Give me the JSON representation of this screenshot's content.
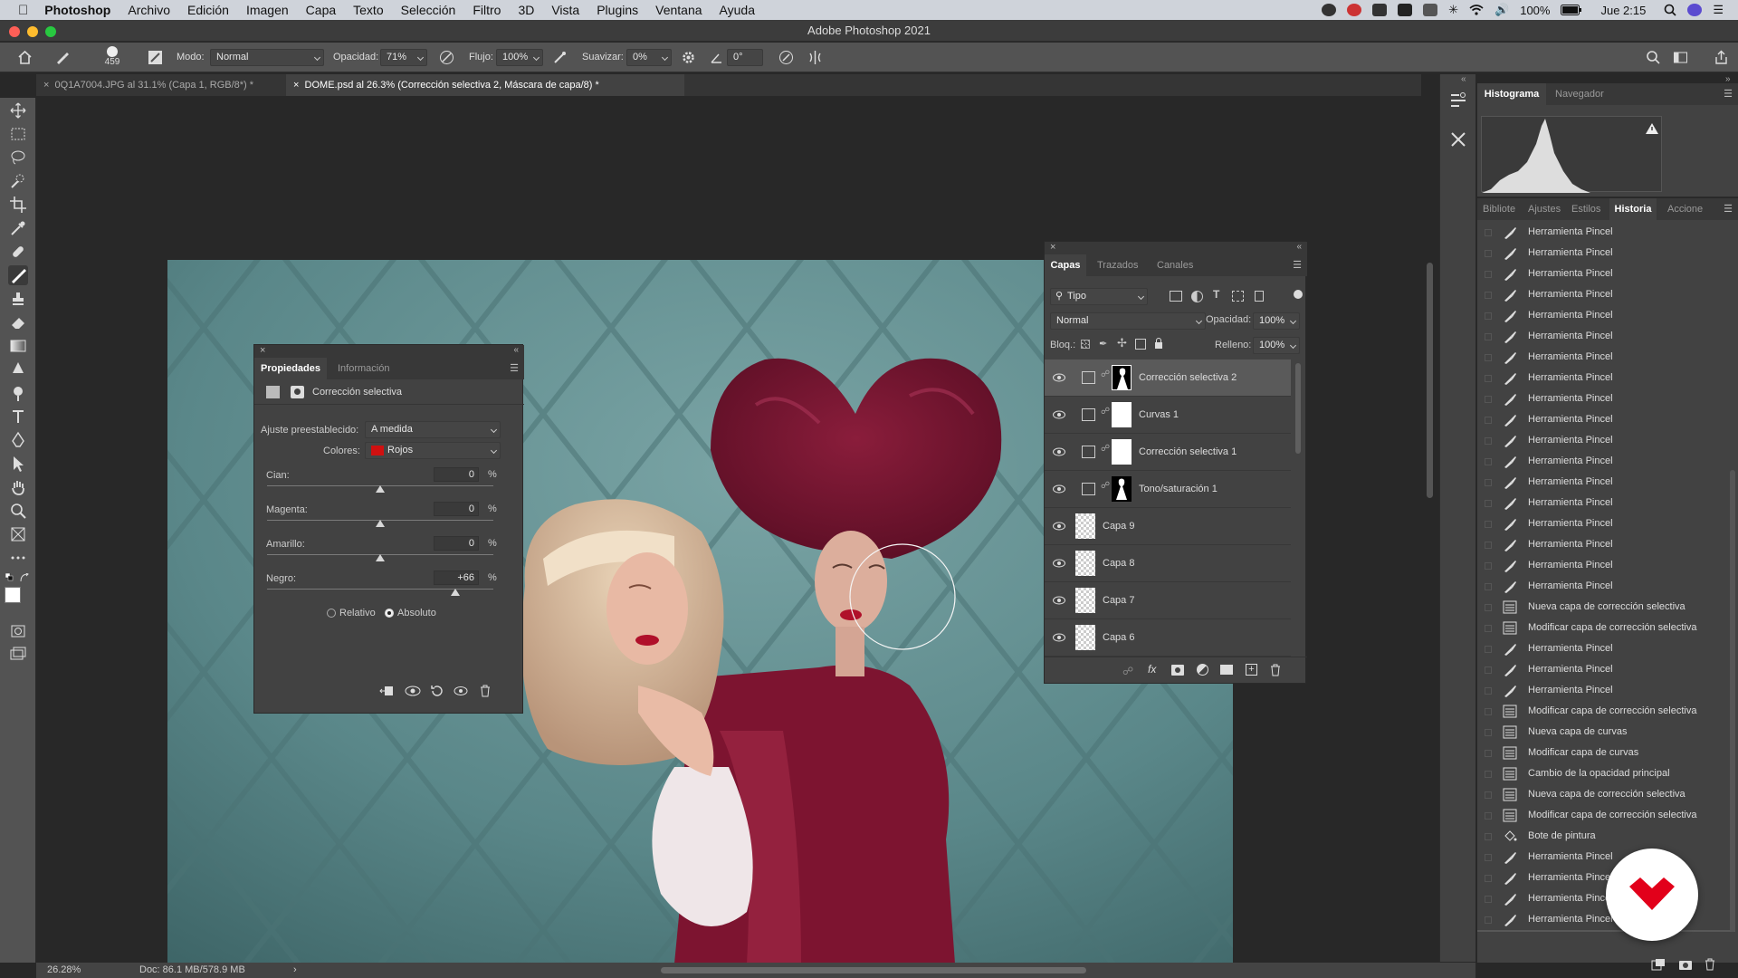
{
  "menubar": {
    "app": "Photoshop",
    "items": [
      "Archivo",
      "Edición",
      "Imagen",
      "Capa",
      "Texto",
      "Selección",
      "Filtro",
      "3D",
      "Vista",
      "Plugins",
      "Ventana",
      "Ayuda"
    ],
    "battery": "100%",
    "clock": "Jue 2:15"
  },
  "window": {
    "title": "Adobe Photoshop 2021"
  },
  "options": {
    "brush_size": "459",
    "mode_label": "Modo:",
    "mode_value": "Normal",
    "opacity_label": "Opacidad:",
    "opacity_value": "71%",
    "flow_label": "Flujo:",
    "flow_value": "100%",
    "smooth_label": "Suavizar:",
    "smooth_value": "0%",
    "angle_value": "0°"
  },
  "tabs": [
    {
      "label": "0Q1A7004.JPG al 31.1% (Capa 1, RGB/8*) *"
    },
    {
      "label": "DOME.psd al 26.3% (Corrección selectiva 2, Máscara de capa/8) *"
    }
  ],
  "properties": {
    "tabs": [
      "Propiedades",
      "Información"
    ],
    "header": "Corrección selectiva",
    "preset_label": "Ajuste preestablecido:",
    "preset_value": "A medida",
    "colors_label": "Colores:",
    "colors_value": "Rojos",
    "colors_swatch": "#d01010",
    "sliders": [
      {
        "label": "Cian:",
        "value": "0",
        "unit": "%",
        "level": 0
      },
      {
        "label": "Magenta:",
        "value": "0",
        "unit": "%",
        "level": 0
      },
      {
        "label": "Amarillo:",
        "value": "0",
        "unit": "%",
        "level": 0
      },
      {
        "label": "Negro:",
        "value": "+66",
        "unit": "%",
        "level": 66
      }
    ],
    "radio_relative": "Relativo",
    "radio_absolute": "Absoluto",
    "method_selected": "Absoluto"
  },
  "layers": {
    "tabs": [
      "Capas",
      "Trazados",
      "Canales"
    ],
    "filter_value": "Tipo",
    "blend_value": "Normal",
    "opacity_label": "Opacidad:",
    "opacity_value": "100%",
    "lock_label": "Bloq.:",
    "fill_label": "Relleno:",
    "fill_value": "100%",
    "items": [
      {
        "name": "Corrección selectiva 2",
        "kind": "adjust-selective",
        "mask": "figure",
        "selected": true
      },
      {
        "name": "Curvas 1",
        "kind": "adjust-curves",
        "mask": "white",
        "selected": false
      },
      {
        "name": "Corrección selectiva 1",
        "kind": "adjust-selective",
        "mask": "white",
        "selected": false
      },
      {
        "name": "Tono/saturación 1",
        "kind": "adjust-hue",
        "mask": "figure",
        "selected": false
      },
      {
        "name": "Capa 9",
        "kind": "pixel",
        "mask": "",
        "selected": false
      },
      {
        "name": "Capa 8",
        "kind": "pixel",
        "mask": "",
        "selected": false
      },
      {
        "name": "Capa 7",
        "kind": "pixel",
        "mask": "",
        "selected": false
      },
      {
        "name": "Capa 6",
        "kind": "pixel",
        "mask": "",
        "selected": false
      }
    ]
  },
  "histogram": {
    "tabs": [
      "Histograma",
      "Navegador"
    ]
  },
  "history": {
    "tabs": [
      "Bibliote",
      "Ajustes",
      "Estilos",
      "Historia",
      "Accione"
    ],
    "items": [
      {
        "label": "Herramienta Pincel",
        "icon": "brush"
      },
      {
        "label": "Herramienta Pincel",
        "icon": "brush"
      },
      {
        "label": "Herramienta Pincel",
        "icon": "brush"
      },
      {
        "label": "Herramienta Pincel",
        "icon": "brush"
      },
      {
        "label": "Herramienta Pincel",
        "icon": "brush"
      },
      {
        "label": "Herramienta Pincel",
        "icon": "brush"
      },
      {
        "label": "Herramienta Pincel",
        "icon": "brush"
      },
      {
        "label": "Herramienta Pincel",
        "icon": "brush"
      },
      {
        "label": "Herramienta Pincel",
        "icon": "brush"
      },
      {
        "label": "Herramienta Pincel",
        "icon": "brush"
      },
      {
        "label": "Herramienta Pincel",
        "icon": "brush"
      },
      {
        "label": "Herramienta Pincel",
        "icon": "brush"
      },
      {
        "label": "Herramienta Pincel",
        "icon": "brush"
      },
      {
        "label": "Herramienta Pincel",
        "icon": "brush"
      },
      {
        "label": "Herramienta Pincel",
        "icon": "brush"
      },
      {
        "label": "Herramienta Pincel",
        "icon": "brush"
      },
      {
        "label": "Herramienta Pincel",
        "icon": "brush"
      },
      {
        "label": "Herramienta Pincel",
        "icon": "brush"
      },
      {
        "label": "Nueva capa de corrección selectiva",
        "icon": "layer"
      },
      {
        "label": "Modificar capa de corrección selectiva",
        "icon": "layer"
      },
      {
        "label": "Herramienta Pincel",
        "icon": "brush"
      },
      {
        "label": "Herramienta Pincel",
        "icon": "brush"
      },
      {
        "label": "Herramienta Pincel",
        "icon": "brush"
      },
      {
        "label": "Modificar capa de corrección selectiva",
        "icon": "layer"
      },
      {
        "label": "Nueva capa de curvas",
        "icon": "layer"
      },
      {
        "label": "Modificar capa de curvas",
        "icon": "layer"
      },
      {
        "label": "Cambio de la opacidad principal",
        "icon": "layer"
      },
      {
        "label": "Nueva capa de corrección selectiva",
        "icon": "layer"
      },
      {
        "label": "Modificar capa de corrección selectiva",
        "icon": "layer"
      },
      {
        "label": "Bote de pintura",
        "icon": "bucket"
      },
      {
        "label": "Herramienta Pincel",
        "icon": "brush"
      },
      {
        "label": "Herramienta Pincel",
        "icon": "brush"
      },
      {
        "label": "Herramienta Pincel",
        "icon": "brush"
      },
      {
        "label": "Herramienta Pincel",
        "icon": "brush"
      },
      {
        "label": "Herramienta Pincel",
        "icon": "brush",
        "selected": true
      }
    ]
  },
  "status": {
    "zoom": "26.28%",
    "doc": "Doc: 86.1 MB/578.9 MB"
  },
  "colors": {
    "accent_red": "#d4001a",
    "canvas_bg": "#5a8a8d",
    "wig": "#7a1533"
  }
}
